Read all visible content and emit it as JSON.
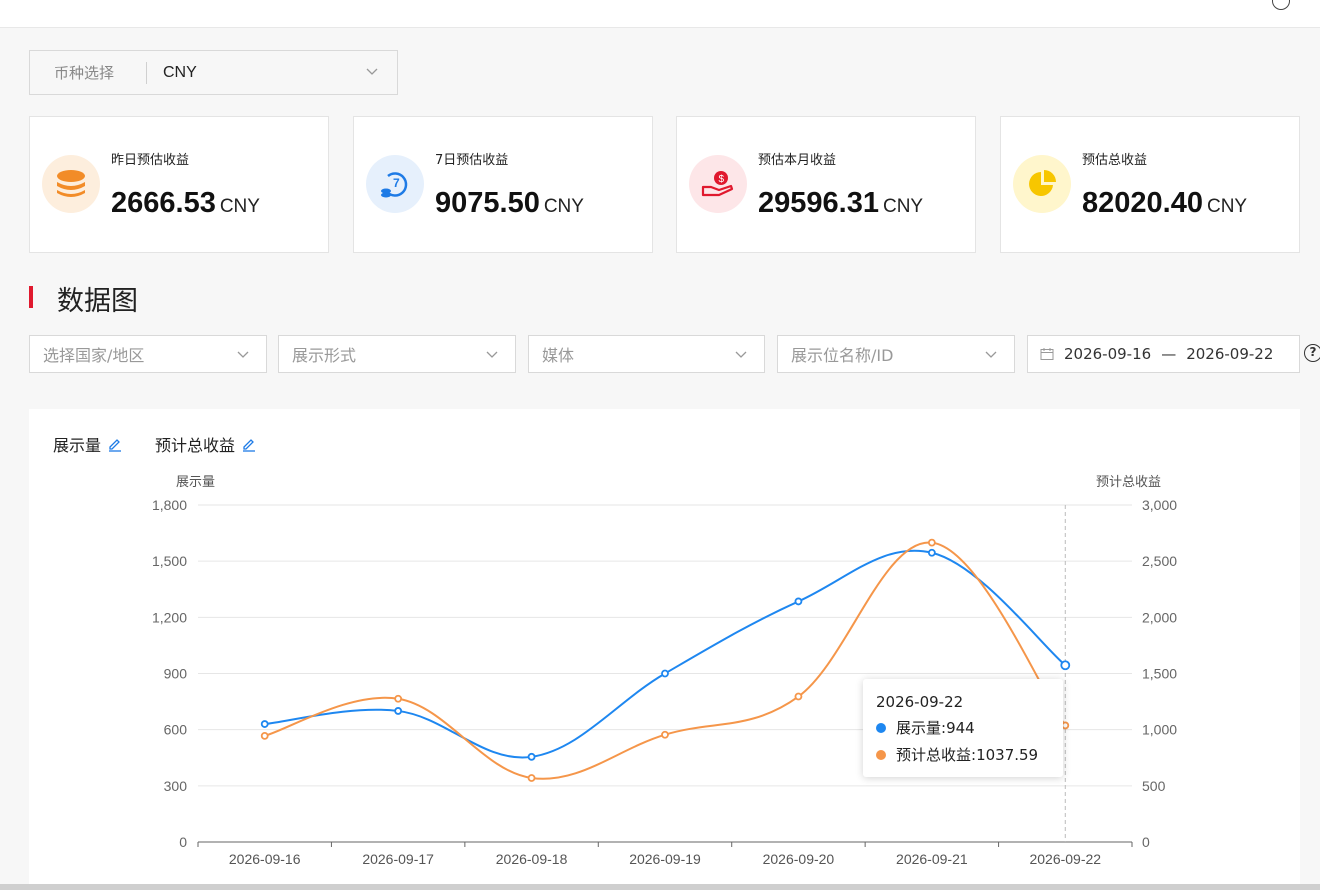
{
  "currency": {
    "label": "币种选择",
    "value": "CNY"
  },
  "cards": [
    {
      "label": "昨日预估收益",
      "value": "2666.53",
      "unit": "CNY",
      "icon": "coin-stack-icon",
      "color": "#f28c28",
      "bg": "#fdeedd"
    },
    {
      "label": "7日预估收益",
      "value": "9075.50",
      "unit": "CNY",
      "icon": "seven-day-cycle-icon",
      "color": "#1e7be6",
      "bg": "#e6f0fc"
    },
    {
      "label": "预估本月收益",
      "value": "29596.31",
      "unit": "CNY",
      "icon": "money-hand-icon",
      "color": "#e0192e",
      "bg": "#fde6e8"
    },
    {
      "label": "预估总收益",
      "value": "82020.40",
      "unit": "CNY",
      "icon": "pie-chart-icon",
      "color": "#f7c600",
      "bg": "#fff6cc"
    }
  ],
  "section": {
    "title": "数据图"
  },
  "filters": [
    {
      "placeholder": "选择国家/地区"
    },
    {
      "placeholder": "展示形式"
    },
    {
      "placeholder": "媒体"
    },
    {
      "placeholder": "展示位名称/ID"
    }
  ],
  "date_range": {
    "start": "2026-09-16",
    "separator": "—",
    "end": "2026-09-22"
  },
  "help": {
    "label": "?"
  },
  "metrics": [
    {
      "label": "展示量"
    },
    {
      "label": "预计总收益"
    }
  ],
  "tooltip": {
    "date": "2026-09-22",
    "rows": [
      {
        "label": "展示量: ",
        "value": "944",
        "color": "#1e87f0"
      },
      {
        "label": "预计总收益: ",
        "value": "1037.59",
        "color": "#f5964a"
      }
    ]
  },
  "chart_data": {
    "type": "line",
    "categories": [
      "2026-09-16",
      "2026-09-17",
      "2026-09-18",
      "2026-09-19",
      "2026-09-20",
      "2026-09-21",
      "2026-09-22"
    ],
    "series": [
      {
        "name": "展示量",
        "axis": "left",
        "color": "#1e87f0",
        "values": [
          630,
          700,
          455,
          900,
          1285,
          1545,
          944
        ]
      },
      {
        "name": "预计总收益",
        "axis": "right",
        "color": "#f5964a",
        "values": [
          945,
          1275,
          570,
          955,
          1295,
          2665,
          1037.59
        ]
      }
    ],
    "ylabel": "展示量",
    "ylabel_right": "预计总收益",
    "ylim": [
      0,
      1800
    ],
    "ylim_right": [
      0,
      3000
    ],
    "yticks": [
      0,
      300,
      600,
      900,
      1200,
      1500,
      1800
    ],
    "yticks_right": [
      0,
      500,
      1000,
      1500,
      2000,
      2500,
      3000
    ],
    "grid": true,
    "highlighted_category": "2026-09-22"
  }
}
